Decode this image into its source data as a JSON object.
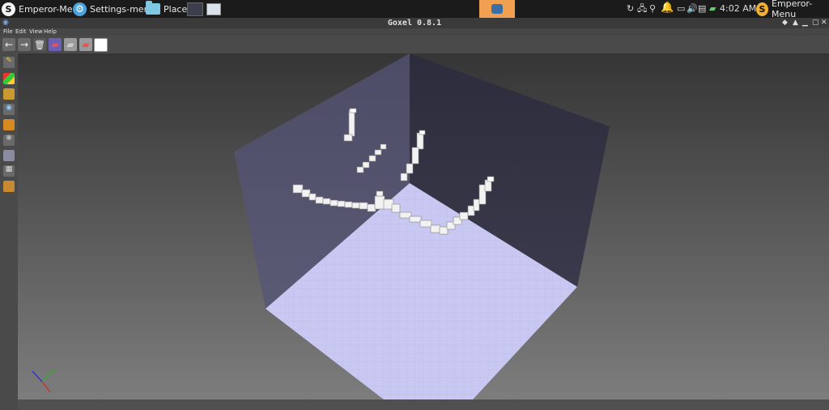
{
  "taskbar": {
    "menu_left_label": "Emperor-Menu",
    "settings_label": "Settings-menu",
    "places_label": "Places",
    "clock": "4:02 AM",
    "menu_right_label": "Emperor-Menu"
  },
  "window": {
    "title": "Goxel 0.8.1"
  },
  "menu": {
    "file": "File",
    "edit": "Edit",
    "view": "View",
    "help": "Help"
  },
  "colors": {
    "palette_swatch": "#ffffff",
    "floor": "#c8c8f0",
    "wall_left": "#4a4a62",
    "wall_right": "#2e2e3e"
  },
  "icons": {
    "toolbar": [
      "undo-icon",
      "redo-icon",
      "trash-icon",
      "layer-icon",
      "layer-icon",
      "layer-icon"
    ],
    "sidebar": [
      "brush-icon",
      "palette-icon",
      "layers-icon",
      "eye-icon",
      "box-icon",
      "material-icon",
      "image-icon",
      "film-icon",
      "camera-icon"
    ]
  }
}
